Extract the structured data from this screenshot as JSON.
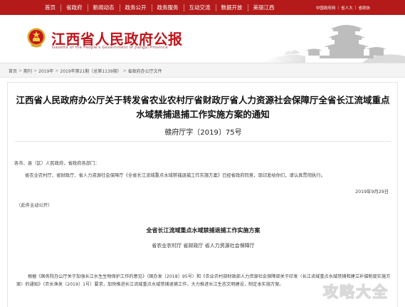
{
  "nav": {
    "items": [
      "首页",
      "省政府",
      "新闻动态",
      "政务公开",
      "政务服务",
      "互动交流",
      "数据开放",
      "美丽江西"
    ],
    "util": [
      "中国政府网",
      "省人大",
      "省政协"
    ]
  },
  "header": {
    "title": "江西省人民政府公报",
    "subtitle": "Gazette of the People's Government of Jiangxi Province"
  },
  "breadcrumb": [
    "首页",
    "期刊",
    "2019年",
    "2019年第21期（总第1139期）",
    "省政府办公厅文件"
  ],
  "article": {
    "title": "江西省人民政府办公厅关于转发省农业农村厅省财政厅省人力资源社会保障厅全省长江流域重点水域禁捕退捕工作实施方案的通知",
    "doc_number": "赣府厅字〔2019〕75号",
    "recipients": "各市、县（区）人民政府，省政府各部门：",
    "body1": "省农业农村厅、省财政厅、省人力资源社会保障厅《全省长江流域重点水域禁捕退捕工作实施方案》已经省政府同意，现印发给你们，请认真贯彻执行。",
    "date": "2019年9月29日",
    "public_note": "（此件主动公开）",
    "plan_title": "全省长江流域重点水域禁捕退捕工作实施方案",
    "issuers": "省农业农村厅  省财政厅  省人力资源社会保障厅",
    "paragraph": "根据《国务院办公厅关于加强长江水生生物保护工作的意见》（国办发〔2018〕95号）和《农业农村部财政部人力资源社会保障部关于印发〈长江流域重点水域禁捕和建立补偿制度实施方案〉的通知》（农长渔发〔2019〕1号）要求，加快推进长江流域重点水域禁捕退捕工作，大力推进长江生态文明建设，制定本实施方案。"
  },
  "watermark": "攻略大全",
  "colors": {
    "nav_red": "#b41a1a",
    "title_red": "#c0151b"
  }
}
